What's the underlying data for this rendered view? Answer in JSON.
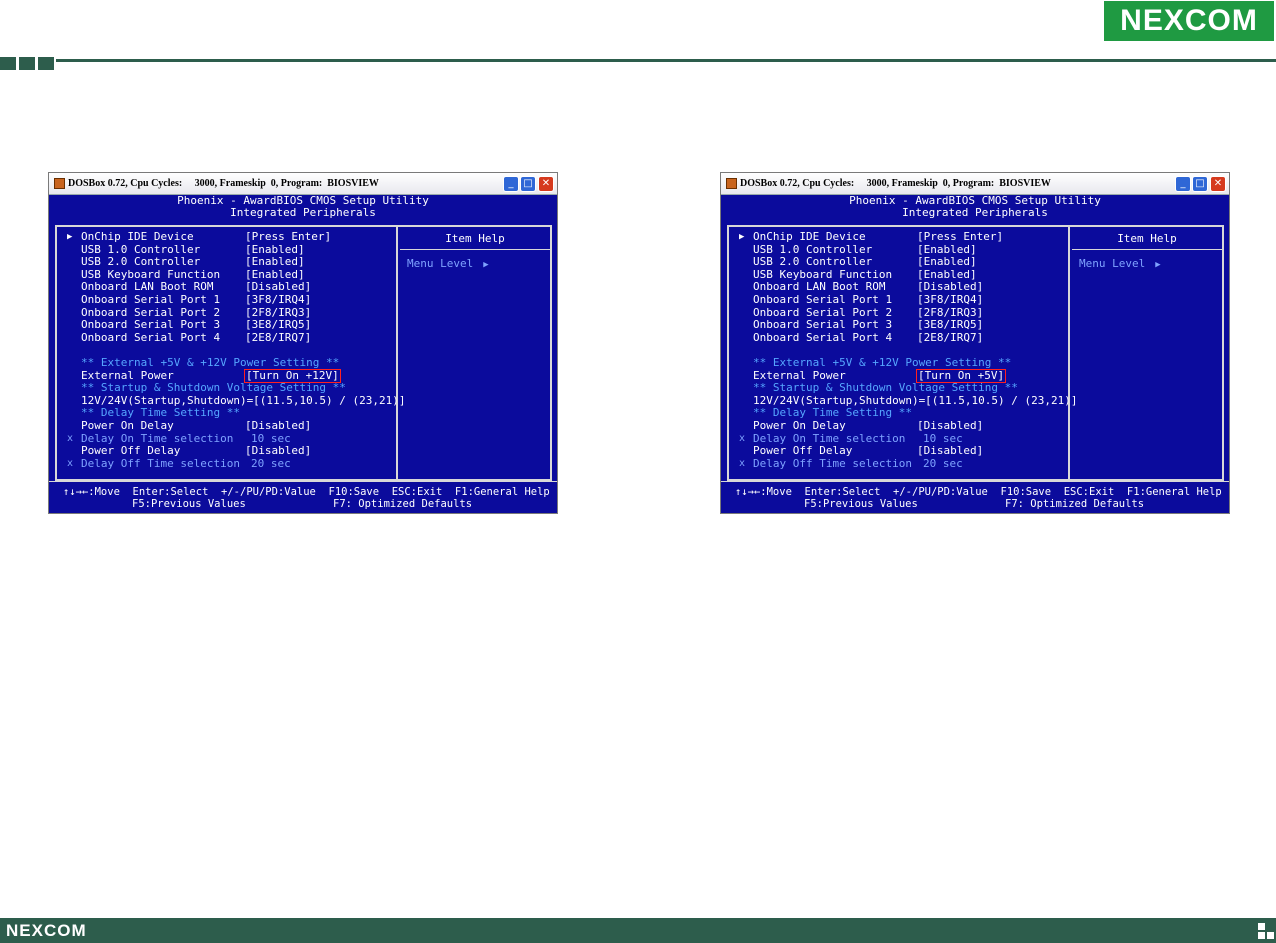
{
  "brand": {
    "name_top": "NEXCOM",
    "name_bottom": "NEXCOM"
  },
  "colors": {
    "brand_green": "#1f9a42",
    "bar_green": "#2d5d4c",
    "bios_blue": "#0b0b9c",
    "highlight_red": "#ff2020"
  },
  "windows": [
    {
      "title": "DOSBox 0.72, Cpu Cycles:     3000, Frameskip  0, Program:  BIOSVIEW",
      "bios_title": "Phoenix - AwardBIOS CMOS Setup Utility",
      "bios_subtitle": "Integrated Peripherals",
      "help_title": "Item Help",
      "help_menu_level": "Menu Level",
      "items": {
        "onchip_ide": {
          "label": "OnChip IDE Device",
          "value": "[Press Enter]"
        },
        "usb10": {
          "label": "USB 1.0 Controller",
          "value": "[Enabled]"
        },
        "usb20": {
          "label": "USB 2.0 Controller",
          "value": "[Enabled]"
        },
        "usb_kb": {
          "label": "USB Keyboard Function",
          "value": "[Enabled]"
        },
        "lan_boot": {
          "label": "Onboard LAN Boot ROM",
          "value": "[Disabled]"
        },
        "serial1": {
          "label": "Onboard Serial Port 1",
          "value": "[3F8/IRQ4]"
        },
        "serial2": {
          "label": "Onboard Serial Port 2",
          "value": "[2F8/IRQ3]"
        },
        "serial3": {
          "label": "Onboard Serial Port 3",
          "value": "[3E8/IRQ5]"
        },
        "serial4": {
          "label": "Onboard Serial Port 4",
          "value": "[2E8/IRQ7]"
        },
        "section_power": "** External +5V & +12V Power Setting **",
        "ext_power": {
          "label": "External Power",
          "value": "[Turn On +12V]"
        },
        "section_voltage": "** Startup & Shutdown Voltage Setting **",
        "voltage": "12V/24V(Startup,Shutdown)=[(11.5,10.5) / (23,21)]",
        "section_delay": "** Delay Time Setting **",
        "power_on_delay": {
          "label": "Power On Delay",
          "value": "[Disabled]"
        },
        "delay_on_sel": {
          "label": "Delay On Time selection",
          "value": "10 sec"
        },
        "power_off_delay": {
          "label": "Power Off Delay",
          "value": "[Disabled]"
        },
        "delay_off_sel": {
          "label": "Delay Off Time selection",
          "value": "20 sec"
        }
      },
      "keys_line1": "↑↓→←:Move  Enter:Select  +/-/PU/PD:Value  F10:Save  ESC:Exit  F1:General Help",
      "keys_line2a": "F5:Previous Values",
      "keys_line2b": "F7: Optimized Defaults"
    },
    {
      "title": "DOSBox 0.72, Cpu Cycles:     3000, Frameskip  0, Program:  BIOSVIEW",
      "bios_title": "Phoenix - AwardBIOS CMOS Setup Utility",
      "bios_subtitle": "Integrated Peripherals",
      "help_title": "Item Help",
      "help_menu_level": "Menu Level",
      "items": {
        "onchip_ide": {
          "label": "OnChip IDE Device",
          "value": "[Press Enter]"
        },
        "usb10": {
          "label": "USB 1.0 Controller",
          "value": "[Enabled]"
        },
        "usb20": {
          "label": "USB 2.0 Controller",
          "value": "[Enabled]"
        },
        "usb_kb": {
          "label": "USB Keyboard Function",
          "value": "[Enabled]"
        },
        "lan_boot": {
          "label": "Onboard LAN Boot ROM",
          "value": "[Disabled]"
        },
        "serial1": {
          "label": "Onboard Serial Port 1",
          "value": "[3F8/IRQ4]"
        },
        "serial2": {
          "label": "Onboard Serial Port 2",
          "value": "[2F8/IRQ3]"
        },
        "serial3": {
          "label": "Onboard Serial Port 3",
          "value": "[3E8/IRQ5]"
        },
        "serial4": {
          "label": "Onboard Serial Port 4",
          "value": "[2E8/IRQ7]"
        },
        "section_power": "** External +5V & +12V Power Setting **",
        "ext_power": {
          "label": "External Power",
          "value": "[Turn On +5V]"
        },
        "section_voltage": "** Startup & Shutdown Voltage Setting **",
        "voltage": "12V/24V(Startup,Shutdown)=[(11.5,10.5) / (23,21)]",
        "section_delay": "** Delay Time Setting **",
        "power_on_delay": {
          "label": "Power On Delay",
          "value": "[Disabled]"
        },
        "delay_on_sel": {
          "label": "Delay On Time selection",
          "value": "10 sec"
        },
        "power_off_delay": {
          "label": "Power Off Delay",
          "value": "[Disabled]"
        },
        "delay_off_sel": {
          "label": "Delay Off Time selection",
          "value": "20 sec"
        }
      },
      "keys_line1": "↑↓→←:Move  Enter:Select  +/-/PU/PD:Value  F10:Save  ESC:Exit  F1:General Help",
      "keys_line2a": "F5:Previous Values",
      "keys_line2b": "F7: Optimized Defaults"
    }
  ]
}
